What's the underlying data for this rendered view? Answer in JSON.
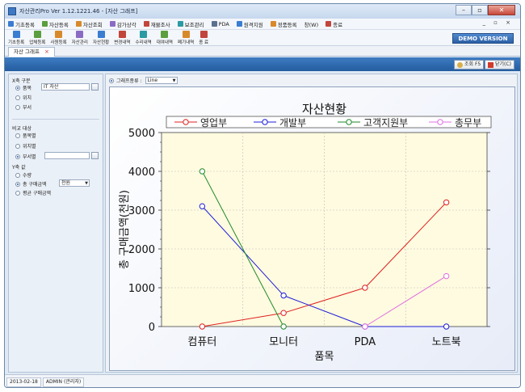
{
  "window": {
    "title": "자산관리Pro Ver 1.12.1221.46 - [자산 그래프]"
  },
  "menu": [
    {
      "label": "기초등록",
      "color": "#3a7dd1"
    },
    {
      "label": "자산등록",
      "color": "#5a9e3d"
    },
    {
      "label": "자산조회",
      "color": "#d88a2b"
    },
    {
      "label": "감가상각",
      "color": "#8a6bc4"
    },
    {
      "label": "재물조사",
      "color": "#c2453b"
    },
    {
      "label": "보조관리",
      "color": "#2b9aa3"
    },
    {
      "label": "PDA",
      "color": "#5b6f8f"
    },
    {
      "label": "원격지원",
      "color": "#3a7dd1"
    },
    {
      "label": "정품등록",
      "color": "#d88a2b"
    },
    {
      "label": "창(W)",
      "color": ""
    },
    {
      "label": "종료",
      "color": "#c2453b"
    }
  ],
  "mdi_controls": "_ ▫ ×",
  "toolbar": [
    {
      "label": "기초등록",
      "color": "#3a7dd1"
    },
    {
      "label": "업체등록",
      "color": "#5a9e3d"
    },
    {
      "label": "사원등록",
      "color": "#d88a2b"
    },
    {
      "label": "자산관리",
      "color": "#8a6bc4"
    },
    {
      "label": "자산현황",
      "color": "#3a7dd1"
    },
    {
      "label": "변경내역",
      "color": "#c2453b"
    },
    {
      "label": "수리내역",
      "color": "#2b9aa3"
    },
    {
      "label": "대여내역",
      "color": "#5a9e3d"
    },
    {
      "label": "폐기내역",
      "color": "#d88a2b"
    },
    {
      "label": "종 료",
      "color": "#c2453b"
    }
  ],
  "demo_label": "DEMO VERSION",
  "doc_tab": {
    "label": "자산 그래프",
    "close": "×"
  },
  "actions": {
    "search": "조회 F5",
    "close": "닫기(C)"
  },
  "left": {
    "x_group": "X축 구분",
    "x_options": [
      "품목",
      "위치",
      "부서"
    ],
    "x_selected": 0,
    "x_value": "IT 자산",
    "compare_group": "비교 대상",
    "compare_options": [
      "품목별",
      "위치별",
      "부서별"
    ],
    "compare_selected": 2,
    "compare_value": "",
    "y_group": "Y축 값",
    "y_options": [
      "수량",
      "총 구매금액",
      "평균 구매금액"
    ],
    "y_selected": 1,
    "unit_value": "천원"
  },
  "chart_type": {
    "label": "그래프종류 :",
    "value": "Line"
  },
  "chart_data": {
    "type": "line",
    "title": "자산현황",
    "xlabel": "품목",
    "ylabel": "총 구매금액(천원)",
    "categories": [
      "컴퓨터",
      "모니터",
      "PDA",
      "노트북"
    ],
    "ylim": [
      0,
      5000
    ],
    "yticks": [
      0,
      1000,
      2000,
      3000,
      4000,
      5000
    ],
    "grid": true,
    "legend": "top",
    "series": [
      {
        "name": "영업부",
        "color": "#e02020",
        "values": [
          0,
          350,
          1000,
          3200
        ]
      },
      {
        "name": "개발부",
        "color": "#1c1cd8",
        "values": [
          3100,
          800,
          0,
          0
        ]
      },
      {
        "name": "고객지원부",
        "color": "#1f8a2a",
        "values": [
          4000,
          0,
          null,
          null
        ]
      },
      {
        "name": "총무부",
        "color": "#e070e0",
        "values": [
          null,
          null,
          0,
          1300
        ]
      }
    ]
  },
  "status": [
    "2013-02-18",
    "ADMIN (관리자)"
  ]
}
